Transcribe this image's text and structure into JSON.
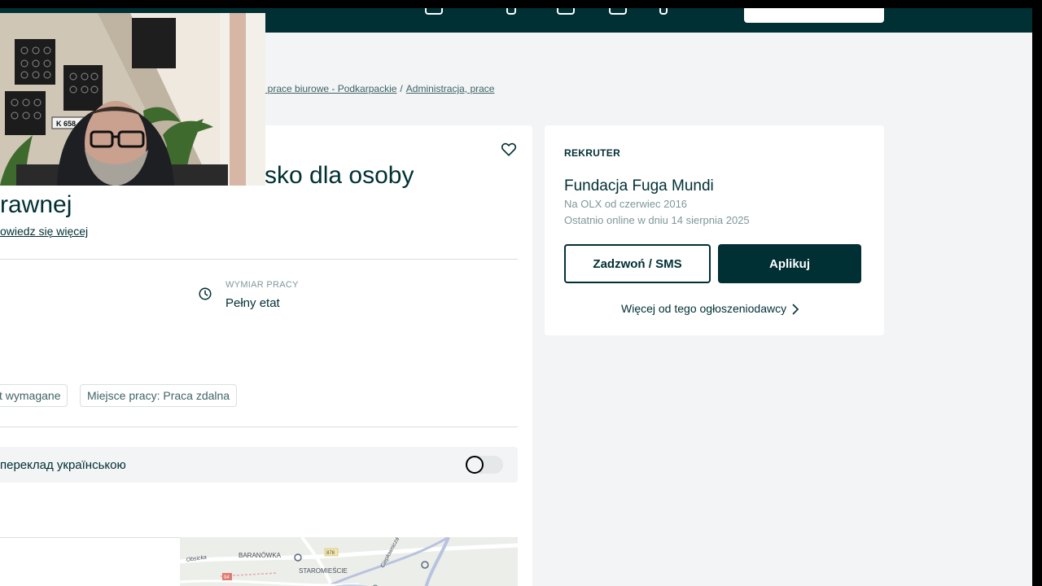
{
  "breadcrumb": {
    "items": [
      {
        "label": ", prace biurowe - Podkarpackie"
      },
      {
        "label": "Administracja, prace"
      }
    ],
    "separator": "/"
  },
  "listing": {
    "title_line1": "sko dla osoby",
    "title_line2": "rawnej",
    "more_link": "owiedz się więcej",
    "attribute": {
      "label": "WYMIAR PRACY",
      "value": "Pełny etat"
    },
    "tags": [
      {
        "label": "t wymagane"
      },
      {
        "label": "Miejsce pracy: Praca zdalna"
      }
    ],
    "translate": {
      "label": "переклад українською",
      "enabled": false
    }
  },
  "recruiter": {
    "section_label": "REKRUTER",
    "name": "Fundacja Fuga Mundi",
    "member_since": "Na OLX od czerwiec 2016",
    "last_online": "Ostatnio online w dniu 14 sierpnia 2025",
    "call_button": "Zadzwoń / SMS",
    "apply_button": "Aplikuj",
    "more_link": "Więcej od tego ogłoszeniodawcy"
  },
  "map": {
    "labels": [
      "BARANÓWKA",
      "STAROMIEŚCIE",
      "Obsicka",
      "878",
      "Ciepłownicza",
      "94"
    ]
  },
  "webcam": {
    "plate_text": "K 658"
  },
  "icons": [
    "heart-icon",
    "clock-icon",
    "chevron-right-icon"
  ],
  "colors": {
    "brand_dark": "#002f34",
    "page_background": "#f2f4f5",
    "card_background": "#ffffff",
    "muted_text": "#7f9799"
  }
}
